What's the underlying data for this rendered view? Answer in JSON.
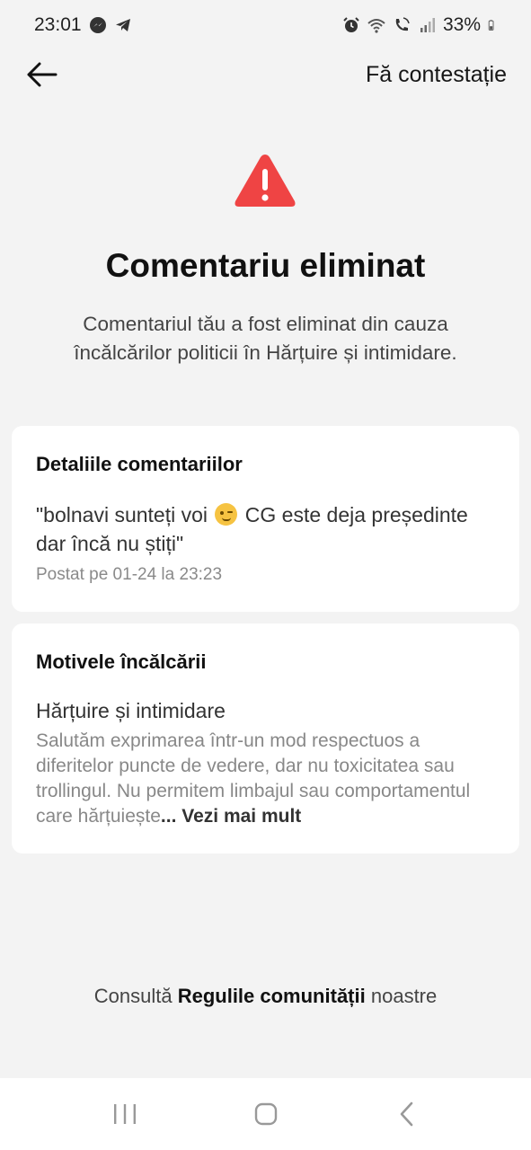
{
  "status_bar": {
    "time": "23:01",
    "battery": "33%",
    "icons_left": [
      "messenger-icon",
      "telegram-icon"
    ],
    "icons_right": [
      "alarm-icon",
      "wifi-icon",
      "wifi-call-icon",
      "signal-icon",
      "battery-icon"
    ]
  },
  "header": {
    "back_icon": "arrow-left-icon",
    "appeal_label": "Fă contestație"
  },
  "hero": {
    "icon": "warning-triangle-icon",
    "icon_color": "#ef4444",
    "title": "Comentariu eliminat",
    "subtitle": "Comentariul tău a fost eliminat din cauza încălcărilor politicii în Hărțuire și intimidare."
  },
  "comment_card": {
    "heading": "Detaliile comentariilor",
    "text_part1": "\"bolnavi sunteți voi",
    "emoji": "winking-face-icon",
    "text_part2": "CG este deja președinte dar încă nu știți\"",
    "posted": "Postat pe 01-24 la 23:23"
  },
  "reasons_card": {
    "heading": "Motivele încălcării",
    "reason_title": "Hărțuire și intimidare",
    "reason_desc": "Salutăm exprimarea într-un mod respectuos a diferitelor puncte de vedere, dar nu toxicitatea sau trollingul. Nu permitem limbajul sau comportamentul care hărțuiește",
    "see_more": "... Vezi mai mult"
  },
  "footer": {
    "prefix": "Consultă",
    "link": "Regulile comunității",
    "suffix": "noastre"
  },
  "nav_bar": {
    "recents_icon": "recents-icon",
    "home_icon": "home-icon",
    "back_icon": "back-chevron-icon"
  }
}
